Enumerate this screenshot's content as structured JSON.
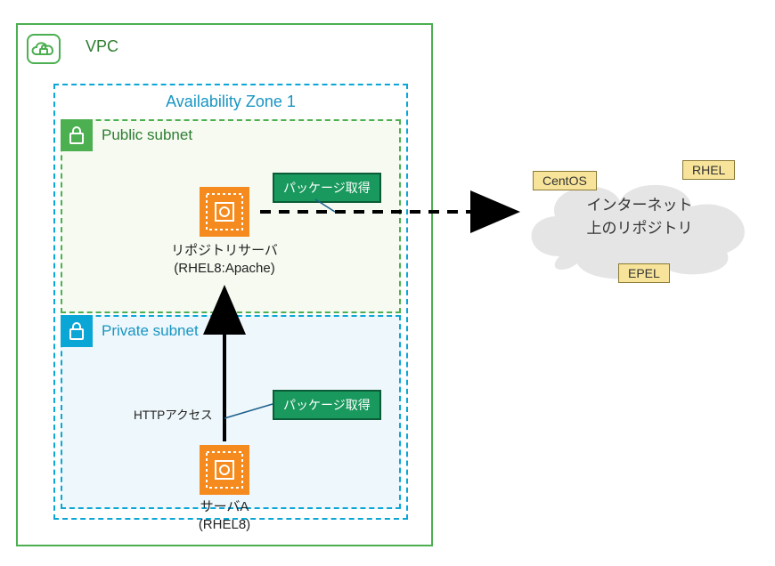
{
  "vpc": {
    "label": "VPC"
  },
  "az": {
    "label": "Availability Zone 1"
  },
  "public_subnet": {
    "label": "Public subnet"
  },
  "private_subnet": {
    "label": "Private subnet"
  },
  "repo_server": {
    "line1": "リポジトリサーバ",
    "line2": "(RHEL8:Apache)"
  },
  "server_a": {
    "line1": "サーバA",
    "line2": "(RHEL8)"
  },
  "tag_pkg_upper": "パッケージ取得",
  "tag_pkg_lower": "パッケージ取得",
  "http_access": "HTTPアクセス",
  "cloud": {
    "line1": "インターネット",
    "line2": "上のリポジトリ"
  },
  "repos": {
    "centos": "CentOS",
    "rhel": "RHEL",
    "epel": "EPEL"
  }
}
